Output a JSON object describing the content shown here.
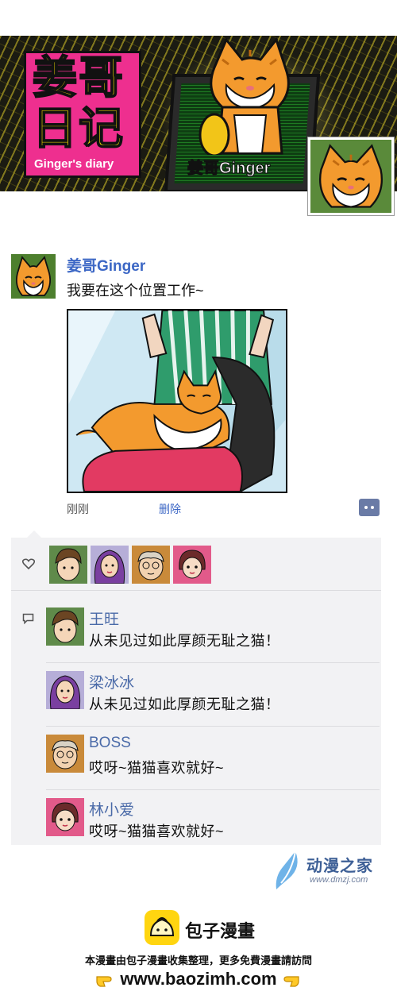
{
  "cover": {
    "logo_line1": "姜哥",
    "logo_line2": "日记",
    "logo_subtitle": "Ginger's diary",
    "caption": "姜哥Ginger"
  },
  "post": {
    "author": "姜哥Ginger",
    "text": "我要在这个位置工作~",
    "time": "刚刚",
    "delete_label": "删除"
  },
  "likes": {
    "count": 4
  },
  "comments": [
    {
      "name": "王旺",
      "text": "从未见过如此厚颜无耻之猫！"
    },
    {
      "name": "梁冰冰",
      "text": "从未见过如此厚颜无耻之猫！"
    },
    {
      "name": "BOSS",
      "text": "哎呀~猫猫喜欢就好~"
    },
    {
      "name": "林小爱",
      "text": "哎呀~猫猫喜欢就好~"
    }
  ],
  "watermark": {
    "brand": "动漫之家",
    "url": "www.dmzj.com"
  },
  "footer": {
    "name": "包子漫畫",
    "description": "本漫畫由包子漫畫收集整理，更多免費漫畫請訪問",
    "url": "www.baozimh.com"
  },
  "colors": {
    "accent_blue": "#3c67c5",
    "comment_name": "#4a6aa8",
    "logo_pink": "#ee2f8f",
    "logo_yellow": "#ffe600",
    "panel_bg": "#f2f2f4",
    "baozi_yellow": "#ffd510"
  },
  "icons": [
    "heart-icon",
    "comment-icon",
    "more-icon",
    "dmzj-logo-icon",
    "baozi-logo-icon",
    "pointing-hand-icon"
  ]
}
